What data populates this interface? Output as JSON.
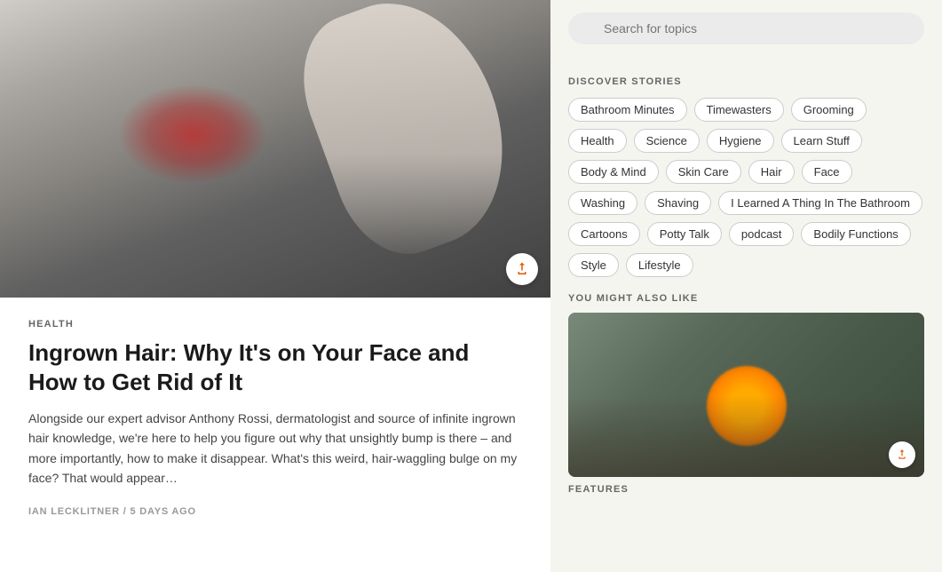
{
  "search": {
    "placeholder": "Search for topics"
  },
  "discover": {
    "label": "DISCOVER STORIES",
    "tags": [
      "Bathroom Minutes",
      "Timewasters",
      "Grooming",
      "Health",
      "Science",
      "Hygiene",
      "Learn Stuff",
      "Body & Mind",
      "Skin Care",
      "Hair",
      "Face",
      "Washing",
      "Shaving",
      "I Learned A Thing In The Bathroom",
      "Cartoons",
      "Potty Talk",
      "podcast",
      "Bodily Functions",
      "Style",
      "Lifestyle"
    ]
  },
  "you_might_also_like": {
    "label": "YOU MIGHT ALSO LIKE"
  },
  "features": {
    "label": "FEATURES"
  },
  "article": {
    "category": "HEALTH",
    "title": "Ingrown Hair: Why It's on Your Face and How to Get Rid of It",
    "excerpt": "Alongside our expert advisor Anthony Rossi, dermatologist and source of infinite ingrown hair knowledge, we're here to help you figure out why that unsightly bump is there – and more importantly, how to make it disappear. What's this weird, hair-waggling bulge on my face? That would appear…",
    "author": "IAN LECKLITNER",
    "published": "5 DAYS AGO"
  }
}
